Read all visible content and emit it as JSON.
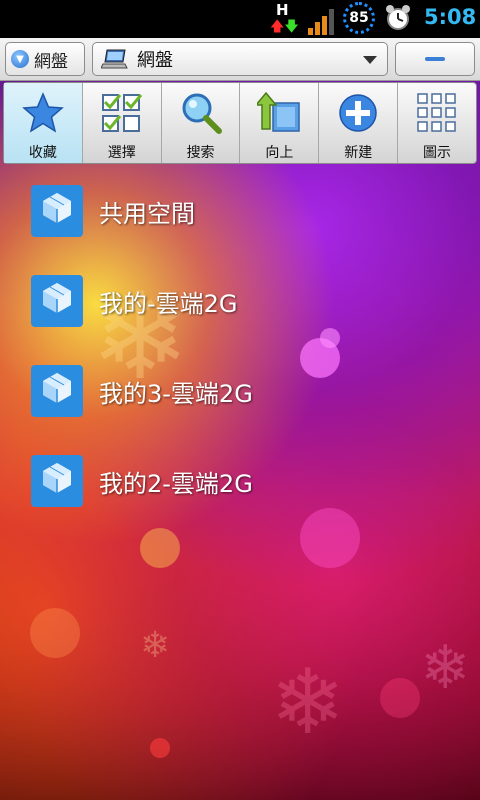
{
  "status_bar": {
    "network_type": "H",
    "battery_level": "85",
    "time": "5:08",
    "icons": [
      "data-activity-icon",
      "signal-strength-icon",
      "battery-icon",
      "alarm-clock-icon"
    ]
  },
  "top_bar": {
    "drive_select_label": "網盤",
    "path_label": "網盤",
    "minus_button_icon": "minus-icon"
  },
  "toolbar": {
    "items": [
      {
        "label": "收藏",
        "icon": "star-icon",
        "active": true
      },
      {
        "label": "選擇",
        "icon": "checklist-icon",
        "active": false
      },
      {
        "label": "搜索",
        "icon": "magnifier-icon",
        "active": false
      },
      {
        "label": "向上",
        "icon": "folder-up-icon",
        "active": false
      },
      {
        "label": "新建",
        "icon": "plus-icon",
        "active": false
      },
      {
        "label": "圖示",
        "icon": "grid-icon",
        "active": false
      }
    ]
  },
  "list": {
    "items": [
      {
        "label": "共用空間",
        "icon": "dropbox-icon"
      },
      {
        "label": "我的-雲端2G",
        "icon": "dropbox-icon"
      },
      {
        "label": "我的3-雲端2G",
        "icon": "dropbox-icon"
      },
      {
        "label": "我的2-雲端2G",
        "icon": "dropbox-icon"
      }
    ]
  },
  "colors": {
    "clock": "#35b9f2",
    "toolbar_active": "#b8e2f4",
    "dropbox_blue": "#2b8de0"
  }
}
